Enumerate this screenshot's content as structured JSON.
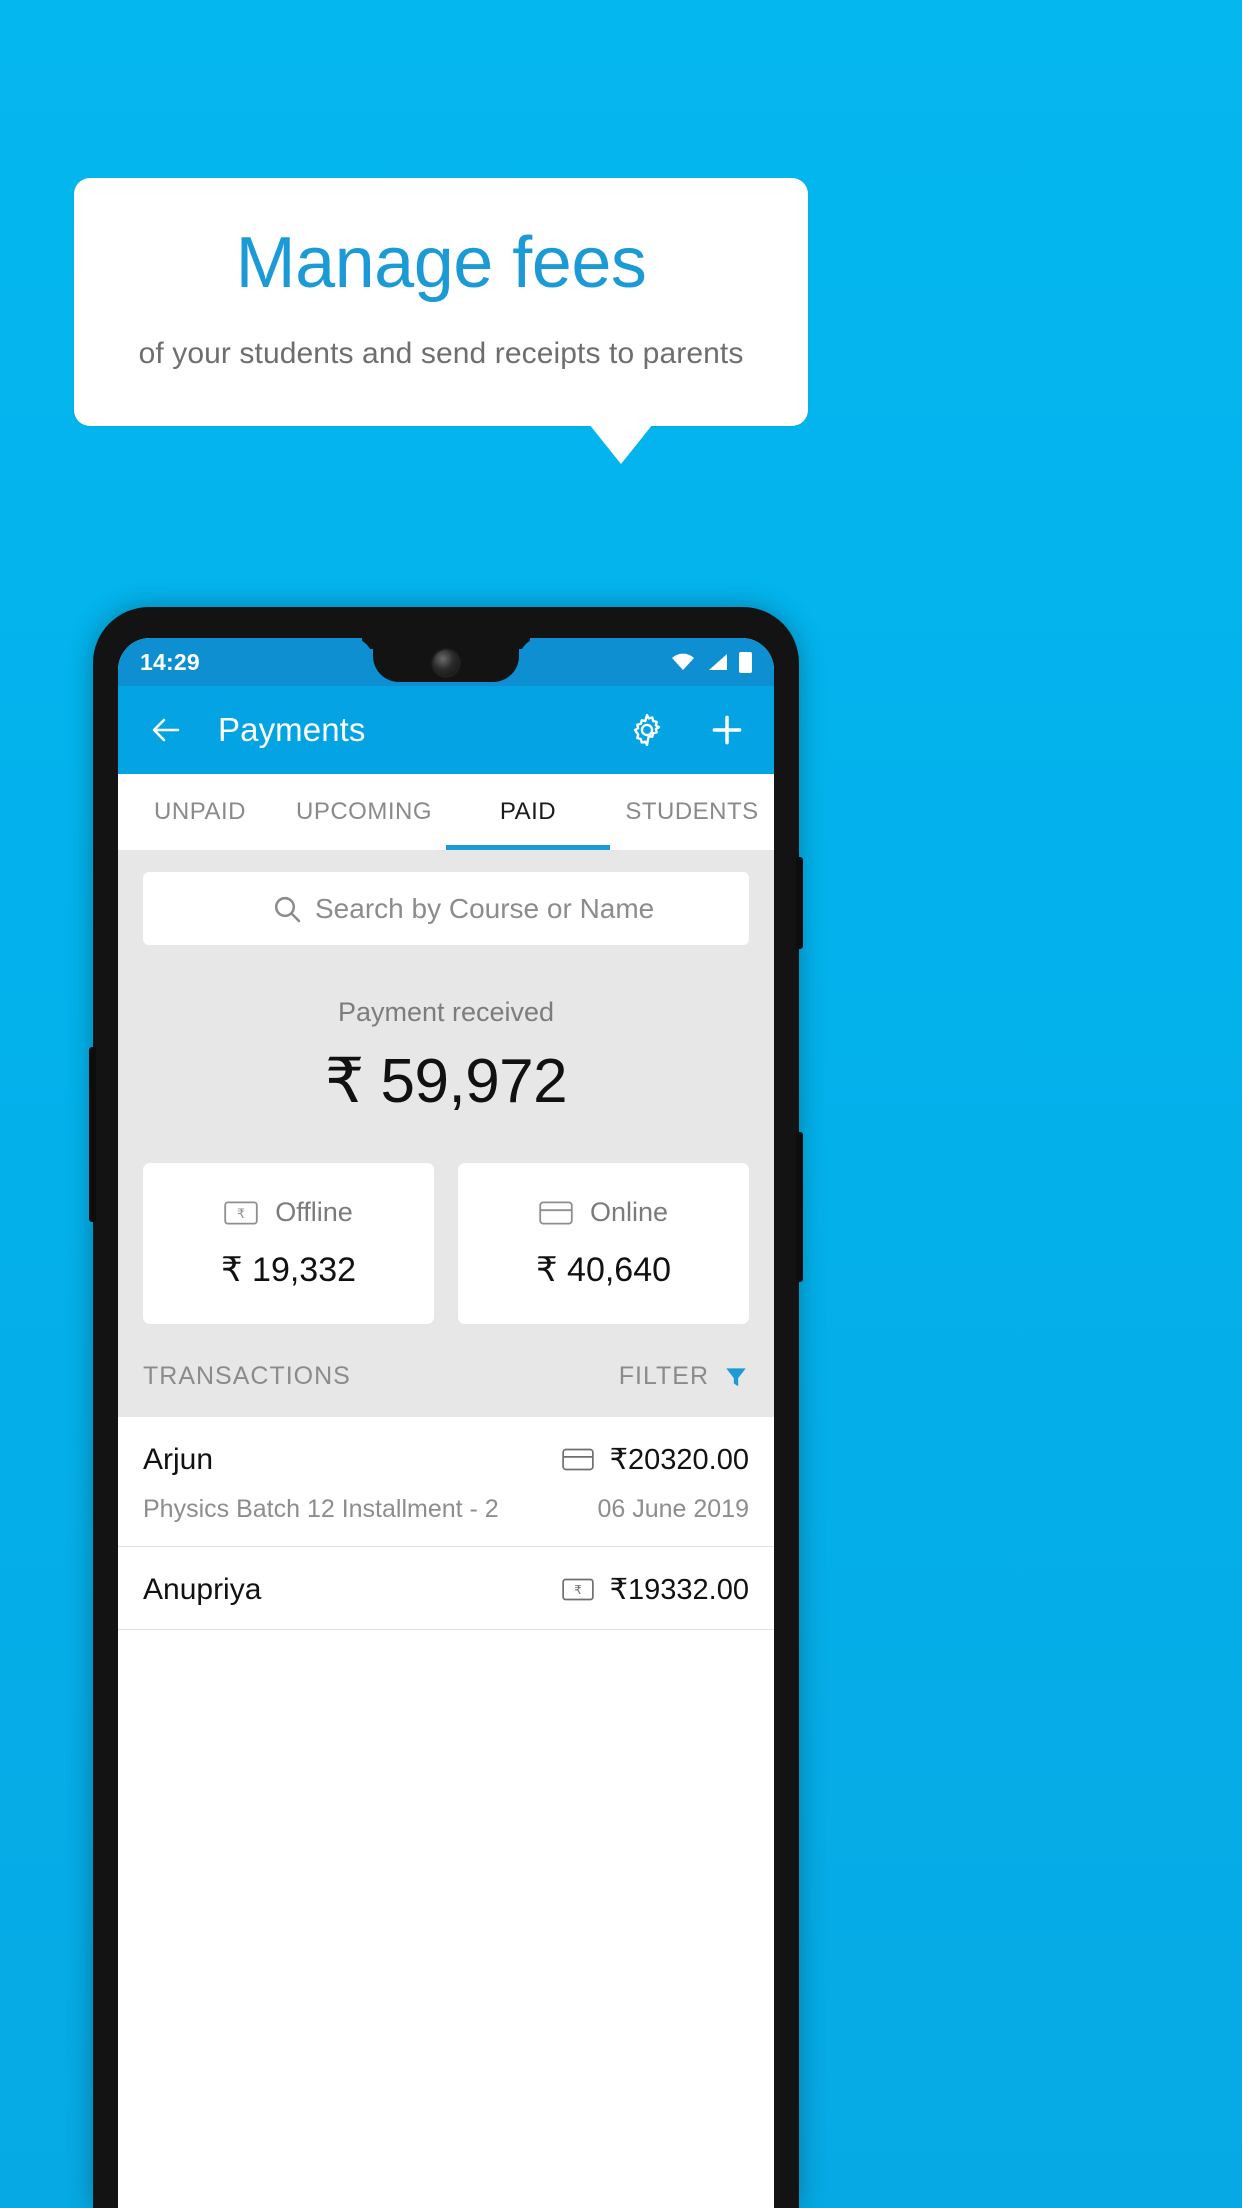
{
  "promo": {
    "headline": "Manage fees",
    "subheadline": "of your students and send receipts to parents",
    "accent_color": "#1c9ad6",
    "background_color": "#03b2ec"
  },
  "phone": {
    "statusbar": {
      "time": "14:29",
      "icons": [
        "wifi-icon",
        "signal-icon",
        "battery-icon"
      ]
    },
    "appbar": {
      "back_label": "back-arrow",
      "title": "Payments",
      "settings_label": "gear-icon",
      "add_label": "plus-icon",
      "background_color": "#03a3e4"
    },
    "tabs": [
      {
        "label": "UNPAID",
        "active": false
      },
      {
        "label": "UPCOMING",
        "active": false
      },
      {
        "label": "PAID",
        "active": true
      },
      {
        "label": "STUDENTS",
        "active": false
      }
    ],
    "search": {
      "placeholder": "Search by Course or Name",
      "value": "",
      "icon": "search-icon"
    },
    "summary": {
      "label": "Payment received",
      "amount": "₹ 59,972"
    },
    "method_cards": [
      {
        "label": "Offline",
        "amount": "₹ 19,332",
        "icon": "cash-note-icon"
      },
      {
        "label": "Online",
        "amount": "₹ 40,640",
        "icon": "credit-card-icon"
      }
    ],
    "transactions_header": {
      "title": "TRANSACTIONS",
      "filter_label": "FILTER",
      "filter_icon": "filter-funnel-icon",
      "filter_icon_color": "#1c9ad6"
    },
    "transactions": [
      {
        "name": "Arjun",
        "description": "Physics Batch 12 Installment - 2",
        "amount": "₹20320.00",
        "date": "06 June 2019",
        "mode_icon": "credit-card-icon"
      },
      {
        "name": "Anupriya",
        "description": "",
        "amount": "₹19332.00",
        "date": "",
        "mode_icon": "cash-note-icon"
      }
    ]
  }
}
